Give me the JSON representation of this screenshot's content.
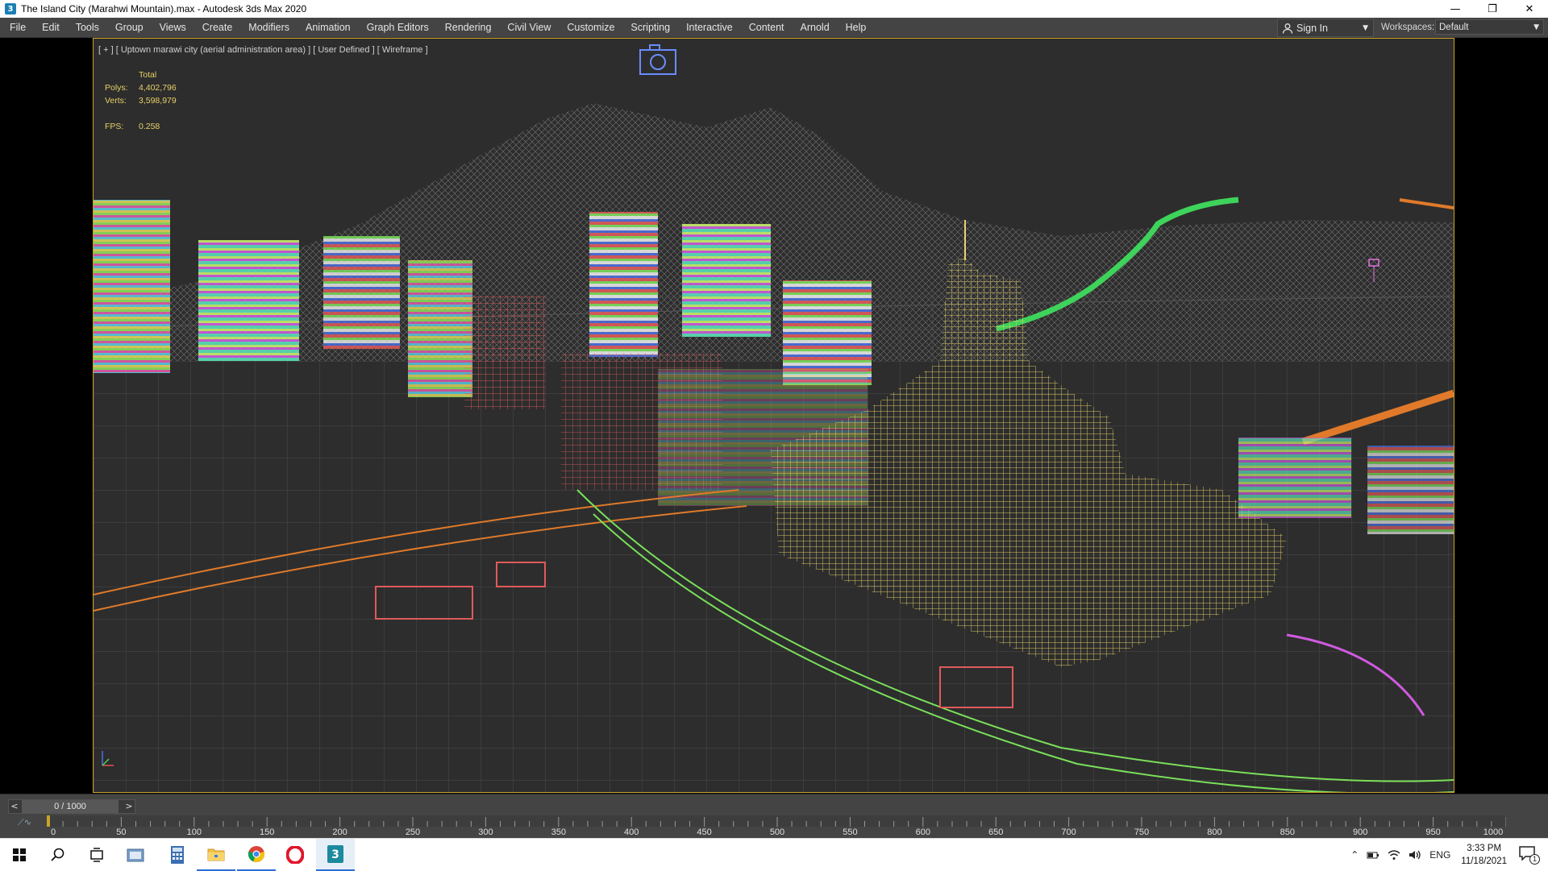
{
  "window": {
    "title": "The Island City (Marahwi Mountain).max - Autodesk 3ds Max 2020",
    "app_icon": "3",
    "controls": {
      "minimize": "—",
      "restore": "❐",
      "close": "✕"
    }
  },
  "menubar": {
    "items": [
      "File",
      "Edit",
      "Tools",
      "Group",
      "Views",
      "Create",
      "Modifiers",
      "Animation",
      "Graph Editors",
      "Rendering",
      "Civil View",
      "Customize",
      "Scripting",
      "Interactive",
      "Content",
      "Arnold",
      "Help"
    ],
    "sign_in": "Sign In",
    "workspaces_label": "Workspaces:",
    "workspaces_value": "Default"
  },
  "viewport": {
    "label": "[ + ] [ Uptown marawi city (aerial administration area) ] [ User Defined ] [ Wireframe ]",
    "border_color": "#c9a227",
    "stats": {
      "header": "Total",
      "polys_label": "Polys:",
      "polys_value": "4,402,796",
      "verts_label": "Verts:",
      "verts_value": "3,598,979",
      "fps_label": "FPS:",
      "fps_value": "0.258"
    }
  },
  "timeline": {
    "frame_display": "0 / 1000",
    "prev": "<",
    "next": ">",
    "ticks": [
      "0",
      "50",
      "100",
      "150",
      "200",
      "250",
      "300",
      "350",
      "400",
      "450",
      "500",
      "550",
      "600",
      "650",
      "700",
      "750",
      "800",
      "850",
      "900",
      "950",
      "1000"
    ],
    "current_frame": 0,
    "total_frames": 1000
  },
  "taskbar": {
    "apps": [
      "start-icon",
      "search-icon",
      "task-view-icon",
      "file-manager-icon",
      "calculator-icon",
      "file-explorer-icon",
      "chrome-icon",
      "opera-icon",
      "3dsmax-icon"
    ],
    "tray": {
      "lang": "ENG",
      "time": "3:33 PM",
      "date": "11/18/2021",
      "notification_count": "1"
    }
  }
}
